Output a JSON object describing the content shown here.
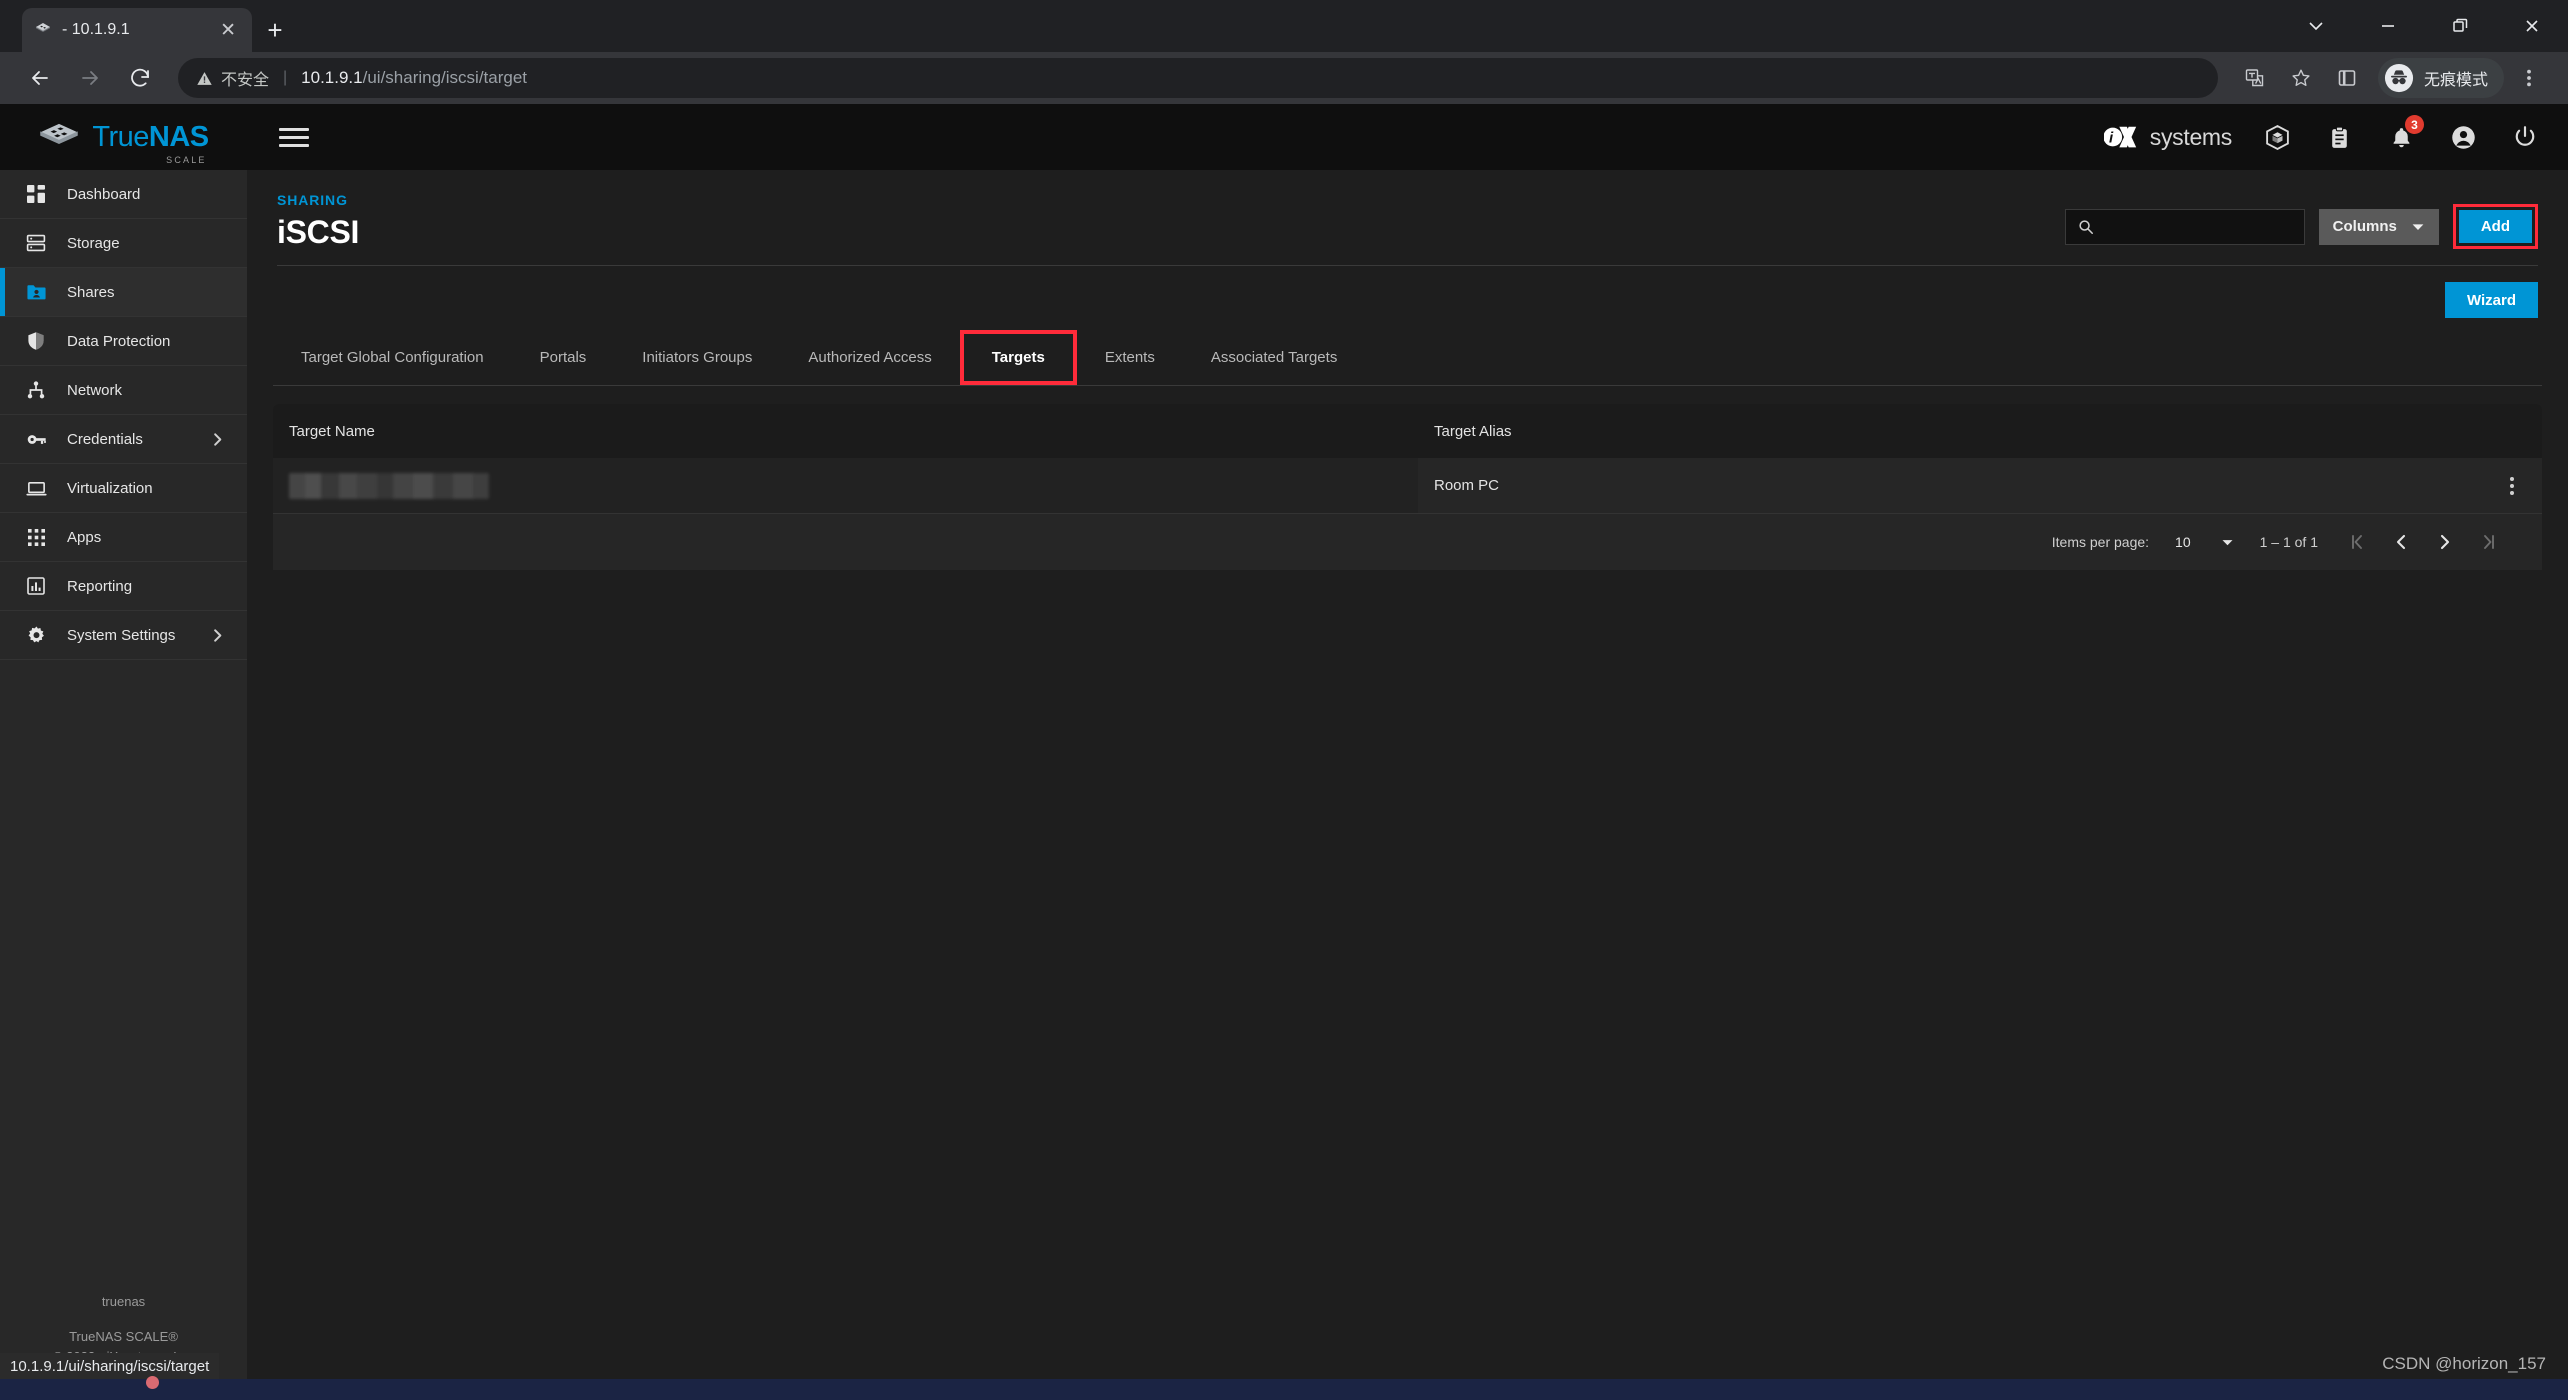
{
  "browser": {
    "tab": {
      "title": "- 10.1.9.1",
      "favicon_icon": "truenas-favicon",
      "close_icon": "close-icon"
    },
    "newtab_icon": "plus-icon",
    "window_controls": [
      {
        "name": "chevron-down-icon",
        "glyph": "chevron-down"
      },
      {
        "name": "minimize-icon",
        "glyph": "minimize"
      },
      {
        "name": "restore-icon",
        "glyph": "restore"
      },
      {
        "name": "close-window-icon",
        "glyph": "close"
      }
    ],
    "nav": {
      "back_icon": "back-arrow-icon",
      "forward_icon": "forward-arrow-icon",
      "reload_icon": "reload-icon"
    },
    "url": {
      "security_label": "不安全",
      "security_icon": "warning-triangle-icon",
      "host": "10.1.9.1",
      "path": "/ui/sharing/iscsi/target"
    },
    "omni_right": {
      "translate_icon": "translate-icon",
      "bookmark_icon": "star-icon",
      "sidepanel_icon": "side-panel-icon",
      "incognito_label": "无痕模式",
      "incognito_icon": "incognito-icon",
      "menu_icon": "kebab-menu-icon"
    },
    "status_url": "10.1.9.1/ui/sharing/iscsi/target"
  },
  "app": {
    "brand": {
      "name_light": "True",
      "name_bold": "NAS",
      "sub": "SCALE",
      "logo_icon": "truenas-logo-icon"
    },
    "hamburger_icon": "hamburger-menu-icon",
    "topbar_icons": [
      {
        "name": "ixsystems-logo",
        "label": "systems"
      },
      {
        "name": "apps-cube-icon"
      },
      {
        "name": "jobs-clipboard-icon"
      },
      {
        "name": "notifications-bell-icon",
        "badge": "3"
      },
      {
        "name": "account-icon"
      },
      {
        "name": "power-icon"
      }
    ]
  },
  "sidebar": {
    "items": [
      {
        "label": "Dashboard",
        "icon": "dashboard-icon",
        "active": false,
        "expandable": false
      },
      {
        "label": "Storage",
        "icon": "storage-icon",
        "active": false,
        "expandable": false
      },
      {
        "label": "Shares",
        "icon": "shares-folder-icon",
        "active": true,
        "expandable": false
      },
      {
        "label": "Data Protection",
        "icon": "shield-icon",
        "active": false,
        "expandable": false
      },
      {
        "label": "Network",
        "icon": "network-icon",
        "active": false,
        "expandable": false
      },
      {
        "label": "Credentials",
        "icon": "key-icon",
        "active": false,
        "expandable": true
      },
      {
        "label": "Virtualization",
        "icon": "monitor-icon",
        "active": false,
        "expandable": false
      },
      {
        "label": "Apps",
        "icon": "apps-grid-icon",
        "active": false,
        "expandable": false
      },
      {
        "label": "Reporting",
        "icon": "reporting-chart-icon",
        "active": false,
        "expandable": false
      },
      {
        "label": "System Settings",
        "icon": "gear-icon",
        "active": false,
        "expandable": true
      }
    ],
    "footer": {
      "hostname": "truenas",
      "product": "TrueNAS SCALE®",
      "copyright": "© 2022 - iXsystems, Inc."
    }
  },
  "page": {
    "eyebrow": "SHARING",
    "title": "iSCSI",
    "search": {
      "placeholder": "",
      "value": "",
      "icon": "search-icon"
    },
    "columns_button": {
      "label": "Columns",
      "icon": "chevron-down-icon"
    },
    "add_button": {
      "label": "Add",
      "highlighted": true
    },
    "wizard_button": {
      "label": "Wizard"
    }
  },
  "tabs": [
    {
      "label": "Target Global Configuration",
      "active": false,
      "marked": false
    },
    {
      "label": "Portals",
      "active": false,
      "marked": false
    },
    {
      "label": "Initiators Groups",
      "active": false,
      "marked": false
    },
    {
      "label": "Authorized Access",
      "active": false,
      "marked": false
    },
    {
      "label": "Targets",
      "active": true,
      "marked": true
    },
    {
      "label": "Extents",
      "active": false,
      "marked": false
    },
    {
      "label": "Associated Targets",
      "active": false,
      "marked": false
    }
  ],
  "table": {
    "columns": [
      "Target Name",
      "Target Alias"
    ],
    "rows": [
      {
        "target_name": "",
        "target_name_redacted": true,
        "target_alias": "Room PC",
        "menu_icon": "row-actions-icon"
      }
    ]
  },
  "paginator": {
    "items_per_page_label": "Items per page:",
    "items_per_page_value": "10",
    "range": "1 – 1 of 1",
    "first_icon": "first-page-icon",
    "prev_icon": "previous-page-icon",
    "next_icon": "next-page-icon",
    "last_icon": "last-page-icon"
  },
  "watermark": "CSDN @horizon_157",
  "colors": {
    "accent": "#0095d5",
    "highlight": "#ff2b3a",
    "badge": "#e13b2f",
    "app_bg": "#1e1e1e",
    "sidebar_bg": "#282828",
    "topbar_bg": "#0f0f0f"
  }
}
